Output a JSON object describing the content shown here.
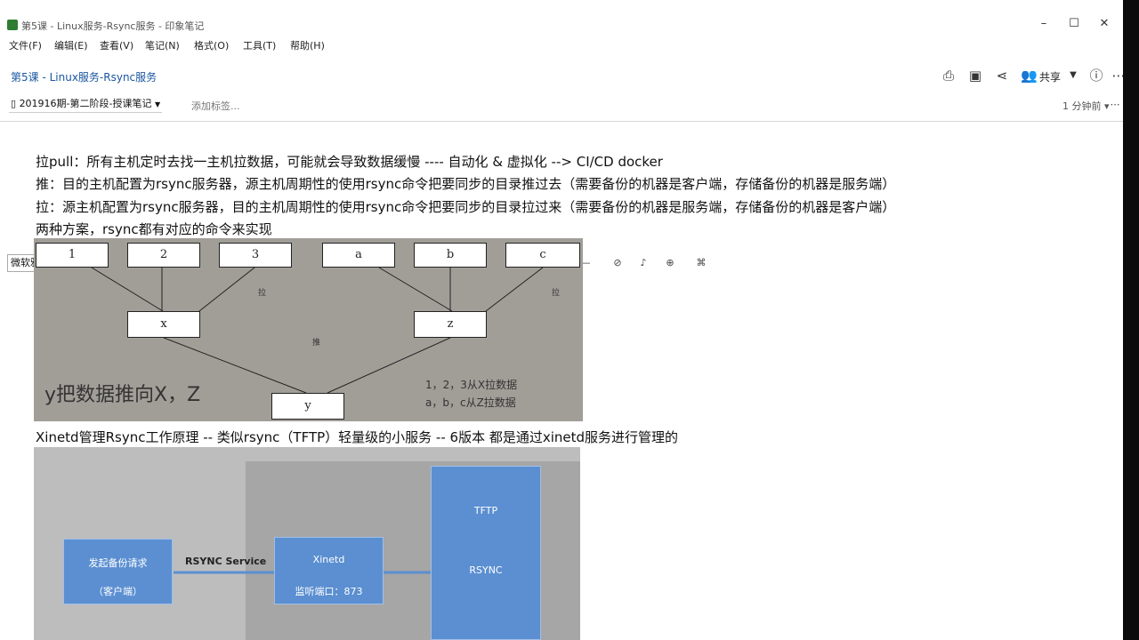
{
  "window": {
    "title": "第5课 - Linux服务-Rsync服务 - 印象笔记"
  },
  "menu": [
    "文件(F)",
    "编辑(E)",
    "查看(V)",
    "笔记(N)",
    "格式(O)",
    "工具(T)",
    "帮助(H)"
  ],
  "note": {
    "title": "第5课 - Linux服务-Rsync服务",
    "notebook": "201916期-第二阶段-授课笔记",
    "add_tag": "添加标签...",
    "share_label": "共享",
    "modified": "1 分钟前"
  },
  "toolbar": {
    "font": "微软雅黑",
    "size": "14"
  },
  "content": {
    "line1": "拉pull：所有主机定时去找一主机拉数据，可能就会导致数据缓慢 ---- 自动化 & 虚拟化 --> CI/CD docker",
    "line2": "推：目的主机配置为rsync服务器，源主机周期性的使用rsync命令把要同步的目录推过去（需要备份的机器是客户端，存储备份的机器是服务端）",
    "line3": "拉：源主机配置为rsync服务器，目的主机周期性的使用rsync命令把要同步的目录拉过来（需要备份的机器是服务端，存储备份的机器是客户端）",
    "line4": "两种方案，rsync都有对应的命令来实现",
    "line5": "Xinetd管理Rsync工作原理 -- 类似rsync（TFTP）轻量级的小服务 -- 6版本 都是通过xinetd服务进行管理的"
  },
  "diagram1": {
    "top_boxes": [
      "1",
      "2",
      "3",
      "a",
      "b",
      "c"
    ],
    "mid_x": "x",
    "mid_z": "z",
    "bottom_y": "y",
    "label_left": "拉",
    "label_right": "拉",
    "label_center": "推",
    "big_text": "y把数据推向X，Z",
    "note1": "1，2，3从X拉数据",
    "note2": "a，b，c从Z拉数据"
  },
  "diagram2": {
    "client_line1": "发起备份请求",
    "client_line2": "（客户端）",
    "arrow_label": "RSYNC Service",
    "xinetd": "Xinetd",
    "port": "监听端口：873",
    "tftp": "TFTP",
    "rsync": "RSYNC",
    "colors": {
      "box": "#5b8fd1",
      "bg": "#bdbdbd"
    }
  }
}
